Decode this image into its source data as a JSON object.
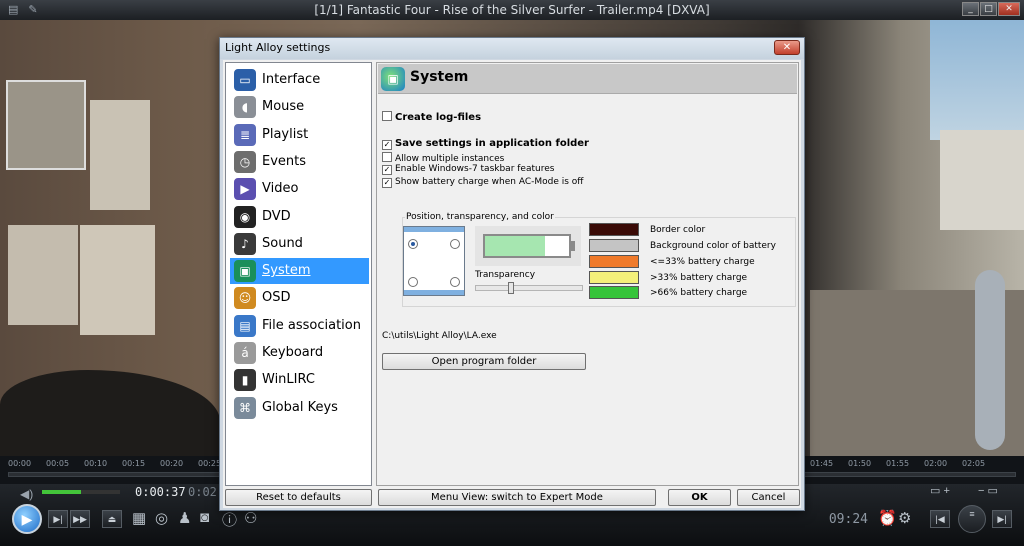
{
  "player": {
    "title": "[1/1] Fantastic Four - Rise of the Silver Surfer - Trailer.mp4  [DXVA]",
    "window_buttons": [
      "_",
      "□",
      "✕"
    ],
    "timeline_marks": [
      "00:00",
      "00:05",
      "00:10",
      "00:15",
      "00:20",
      "00:25",
      "01:45",
      "01:50",
      "01:55",
      "02:00",
      "02:05"
    ],
    "current_time": "0:00:37",
    "remaining_time_partial": "0:02",
    "clock": "09:24",
    "volume_level": 0.5,
    "playback_progress": 0.0
  },
  "dialog": {
    "title": "Light Alloy settings",
    "close_glyph": "✕",
    "categories": [
      {
        "label": "Interface",
        "icon": "monitor-icon",
        "glyph": "▭",
        "color": "#2b5fa8"
      },
      {
        "label": "Mouse",
        "icon": "mouse-icon",
        "glyph": "◖",
        "color": "#8a8f96"
      },
      {
        "label": "Playlist",
        "icon": "playlist-icon",
        "glyph": "≣",
        "color": "#5a6ab8"
      },
      {
        "label": "Events",
        "icon": "clock-icon",
        "glyph": "◷",
        "color": "#6d6d6d"
      },
      {
        "label": "Video",
        "icon": "video-icon",
        "glyph": "▶",
        "color": "#5b4fb0"
      },
      {
        "label": "DVD",
        "icon": "dvd-icon",
        "glyph": "◉",
        "color": "#222222"
      },
      {
        "label": "Sound",
        "icon": "headphones-icon",
        "glyph": "♪",
        "color": "#3a3a3a"
      },
      {
        "label": "System",
        "icon": "system-icon",
        "glyph": "▣",
        "color": "#1a8f5a",
        "selected": true
      },
      {
        "label": "OSD",
        "icon": "osd-icon",
        "glyph": "☺",
        "color": "#d08a20"
      },
      {
        "label": "File association",
        "icon": "file-association-icon",
        "glyph": "▤",
        "color": "#3a78c8"
      },
      {
        "label": "Keyboard",
        "icon": "keyboard-key-icon",
        "glyph": "á",
        "color": "#9a9a9a"
      },
      {
        "label": "WinLIRC",
        "icon": "remote-icon",
        "glyph": "▮",
        "color": "#333333"
      },
      {
        "label": "Global Keys",
        "icon": "global-keys-icon",
        "glyph": "⌘",
        "color": "#7a8a9a"
      }
    ],
    "panel": {
      "title": "System",
      "create_log_files": {
        "label": "Create log-files",
        "checked": false
      },
      "options": [
        {
          "label": "Save settings in application folder",
          "checked": true,
          "bold": true
        },
        {
          "label": "Allow multiple instances",
          "checked": false
        },
        {
          "label": "Enable Windows-7 taskbar features",
          "checked": true
        },
        {
          "label": "Show battery charge when AC-Mode is off",
          "checked": true
        }
      ],
      "group_title": "Position, transparency, and color",
      "transparency_label": "Transparency",
      "transparency_value": 0.3,
      "battery_fill": 0.72,
      "colors": [
        {
          "label": "Border color",
          "color": "#3a0a06"
        },
        {
          "label": "Background color of battery",
          "color": "#c4c4c4"
        },
        {
          "label": "<=33% battery charge",
          "color": "#f07a2a"
        },
        {
          "label": ">33% battery charge",
          "color": "#f4f07a"
        },
        {
          "label": ">66% battery charge",
          "color": "#36c43a"
        }
      ],
      "exe_path": "C:\\utils\\Light Alloy\\LA.exe",
      "open_folder_button": "Open program folder"
    },
    "footer": {
      "reset_button": "Reset to defaults",
      "menu_view_button": "Menu View: switch to Expert Mode",
      "ok_button": "OK",
      "cancel_button": "Cancel"
    }
  }
}
